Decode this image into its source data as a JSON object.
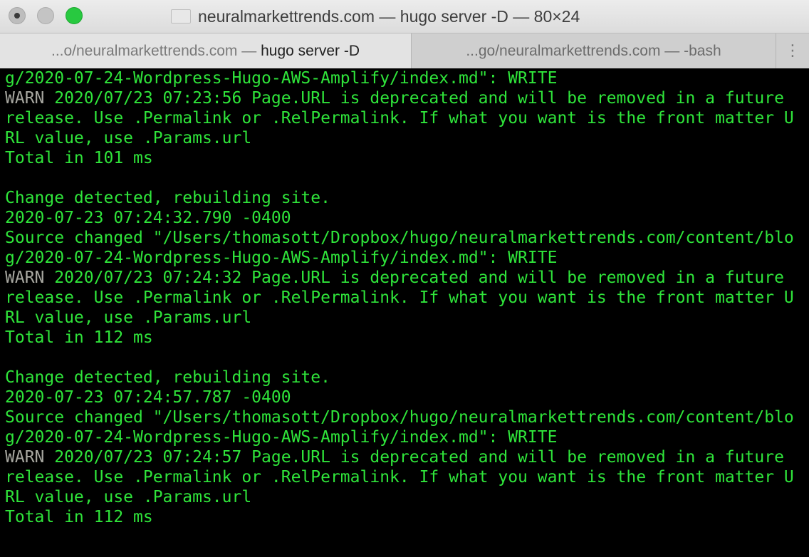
{
  "window": {
    "title": "neuralmarkettrends.com — hugo server -D — 80×24"
  },
  "tabs": [
    {
      "prefix": "...o/neuralmarkettrends.com — ",
      "label": "hugo server -D",
      "active": true
    },
    {
      "label": "...go/neuralmarkettrends.com — -bash",
      "active": false
    }
  ],
  "new_tab_glyph": "⋮",
  "colors": {
    "terminal_bg": "#000000",
    "text_green": "#2fe43a",
    "warn_gray": "#a7a7a0",
    "zoom_green": "#28c940"
  },
  "terminal": {
    "lines": [
      {
        "text": "g/2020-07-24-Wordpress-Hugo-AWS-Amplify/index.md\": WRITE"
      },
      {
        "warn": "WARN",
        "text": " 2020/07/23 07:23:56 Page.URL is deprecated and will be removed in a future"
      },
      {
        "text": "release. Use .Permalink or .RelPermalink. If what you want is the front matter U"
      },
      {
        "text": "RL value, use .Params.url"
      },
      {
        "text": "Total in 101 ms"
      },
      {
        "text": ""
      },
      {
        "text": "Change detected, rebuilding site."
      },
      {
        "text": "2020-07-23 07:24:32.790 -0400"
      },
      {
        "text": "Source changed \"/Users/thomasott/Dropbox/hugo/neuralmarkettrends.com/content/blo"
      },
      {
        "text": "g/2020-07-24-Wordpress-Hugo-AWS-Amplify/index.md\": WRITE"
      },
      {
        "warn": "WARN",
        "text": " 2020/07/23 07:24:32 Page.URL is deprecated and will be removed in a future"
      },
      {
        "text": "release. Use .Permalink or .RelPermalink. If what you want is the front matter U"
      },
      {
        "text": "RL value, use .Params.url"
      },
      {
        "text": "Total in 112 ms"
      },
      {
        "text": ""
      },
      {
        "text": "Change detected, rebuilding site."
      },
      {
        "text": "2020-07-23 07:24:57.787 -0400"
      },
      {
        "text": "Source changed \"/Users/thomasott/Dropbox/hugo/neuralmarkettrends.com/content/blo"
      },
      {
        "text": "g/2020-07-24-Wordpress-Hugo-AWS-Amplify/index.md\": WRITE"
      },
      {
        "warn": "WARN",
        "text": " 2020/07/23 07:24:57 Page.URL is deprecated and will be removed in a future"
      },
      {
        "text": "release. Use .Permalink or .RelPermalink. If what you want is the front matter U"
      },
      {
        "text": "RL value, use .Params.url"
      },
      {
        "text": "Total in 112 ms"
      }
    ]
  }
}
